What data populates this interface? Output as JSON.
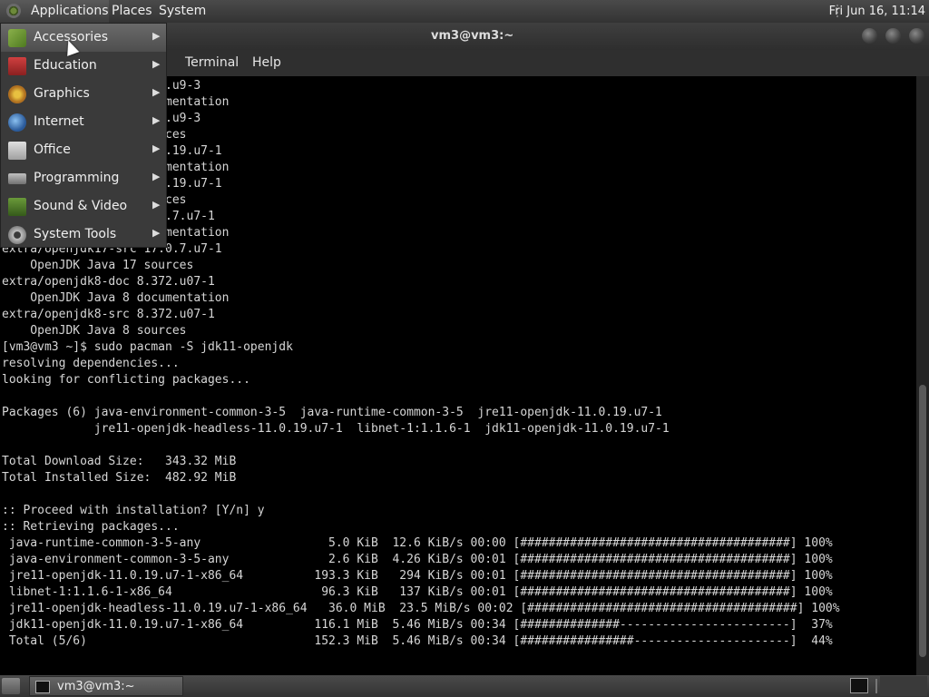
{
  "top_panel": {
    "applications": "Applications",
    "places": "Places",
    "system": "System",
    "clock": "Fri Jun 16, 11:14"
  },
  "window": {
    "title": "vm3@vm3:~",
    "menus": [
      "Terminal",
      "Help"
    ]
  },
  "app_menu": {
    "items": [
      {
        "label": "Accessories",
        "icon": "accessories-icon"
      },
      {
        "label": "Education",
        "icon": "education-icon"
      },
      {
        "label": "Graphics",
        "icon": "graphics-icon"
      },
      {
        "label": "Internet",
        "icon": "internet-icon"
      },
      {
        "label": "Office",
        "icon": "office-icon"
      },
      {
        "label": "Programming",
        "icon": "programming-icon"
      },
      {
        "label": "Sound & Video",
        "icon": "sound-video-icon"
      },
      {
        "label": "System Tools",
        "icon": "system-tools-icon"
      }
    ]
  },
  "terminal": {
    "lines": [
      "                      1.u9-3",
      "                      umentation",
      "                      1.u9-3",
      "                      rces",
      "                      0.19.u7-1",
      "                      umentation",
      "                      0.19.u7-1",
      "                      rces",
      "                      0.7.u7-1",
      "                      umentation",
      "extra/openjdk17-src 17.0.7.u7-1",
      "    OpenJDK Java 17 sources",
      "extra/openjdk8-doc 8.372.u07-1",
      "    OpenJDK Java 8 documentation",
      "extra/openjdk8-src 8.372.u07-1",
      "    OpenJDK Java 8 sources",
      "[vm3@vm3 ~]$ sudo pacman -S jdk11-openjdk",
      "resolving dependencies...",
      "looking for conflicting packages...",
      "",
      "Packages (6) java-environment-common-3-5  java-runtime-common-3-5  jre11-openjdk-11.0.19.u7-1",
      "             jre11-openjdk-headless-11.0.19.u7-1  libnet-1:1.1.6-1  jdk11-openjdk-11.0.19.u7-1",
      "",
      "Total Download Size:   343.32 MiB",
      "Total Installed Size:  482.92 MiB",
      "",
      ":: Proceed with installation? [Y/n] y",
      ":: Retrieving packages...",
      " java-runtime-common-3-5-any                  5.0 KiB  12.6 KiB/s 00:00 [######################################] 100%",
      " java-environment-common-3-5-any              2.6 KiB  4.26 KiB/s 00:01 [######################################] 100%",
      " jre11-openjdk-11.0.19.u7-1-x86_64          193.3 KiB   294 KiB/s 00:01 [######################################] 100%",
      " libnet-1:1.1.6-1-x86_64                     96.3 KiB   137 KiB/s 00:01 [######################################] 100%",
      " jre11-openjdk-headless-11.0.19.u7-1-x86_64   36.0 MiB  23.5 MiB/s 00:02 [######################################] 100%",
      " jdk11-openjdk-11.0.19.u7-1-x86_64          116.1 MiB  5.46 MiB/s 00:34 [##############------------------------]  37%",
      " Total (5/6)                                152.3 MiB  5.46 MiB/s 00:34 [################----------------------]  44%"
    ]
  },
  "taskbar": {
    "task_label": "vm3@vm3:~"
  }
}
